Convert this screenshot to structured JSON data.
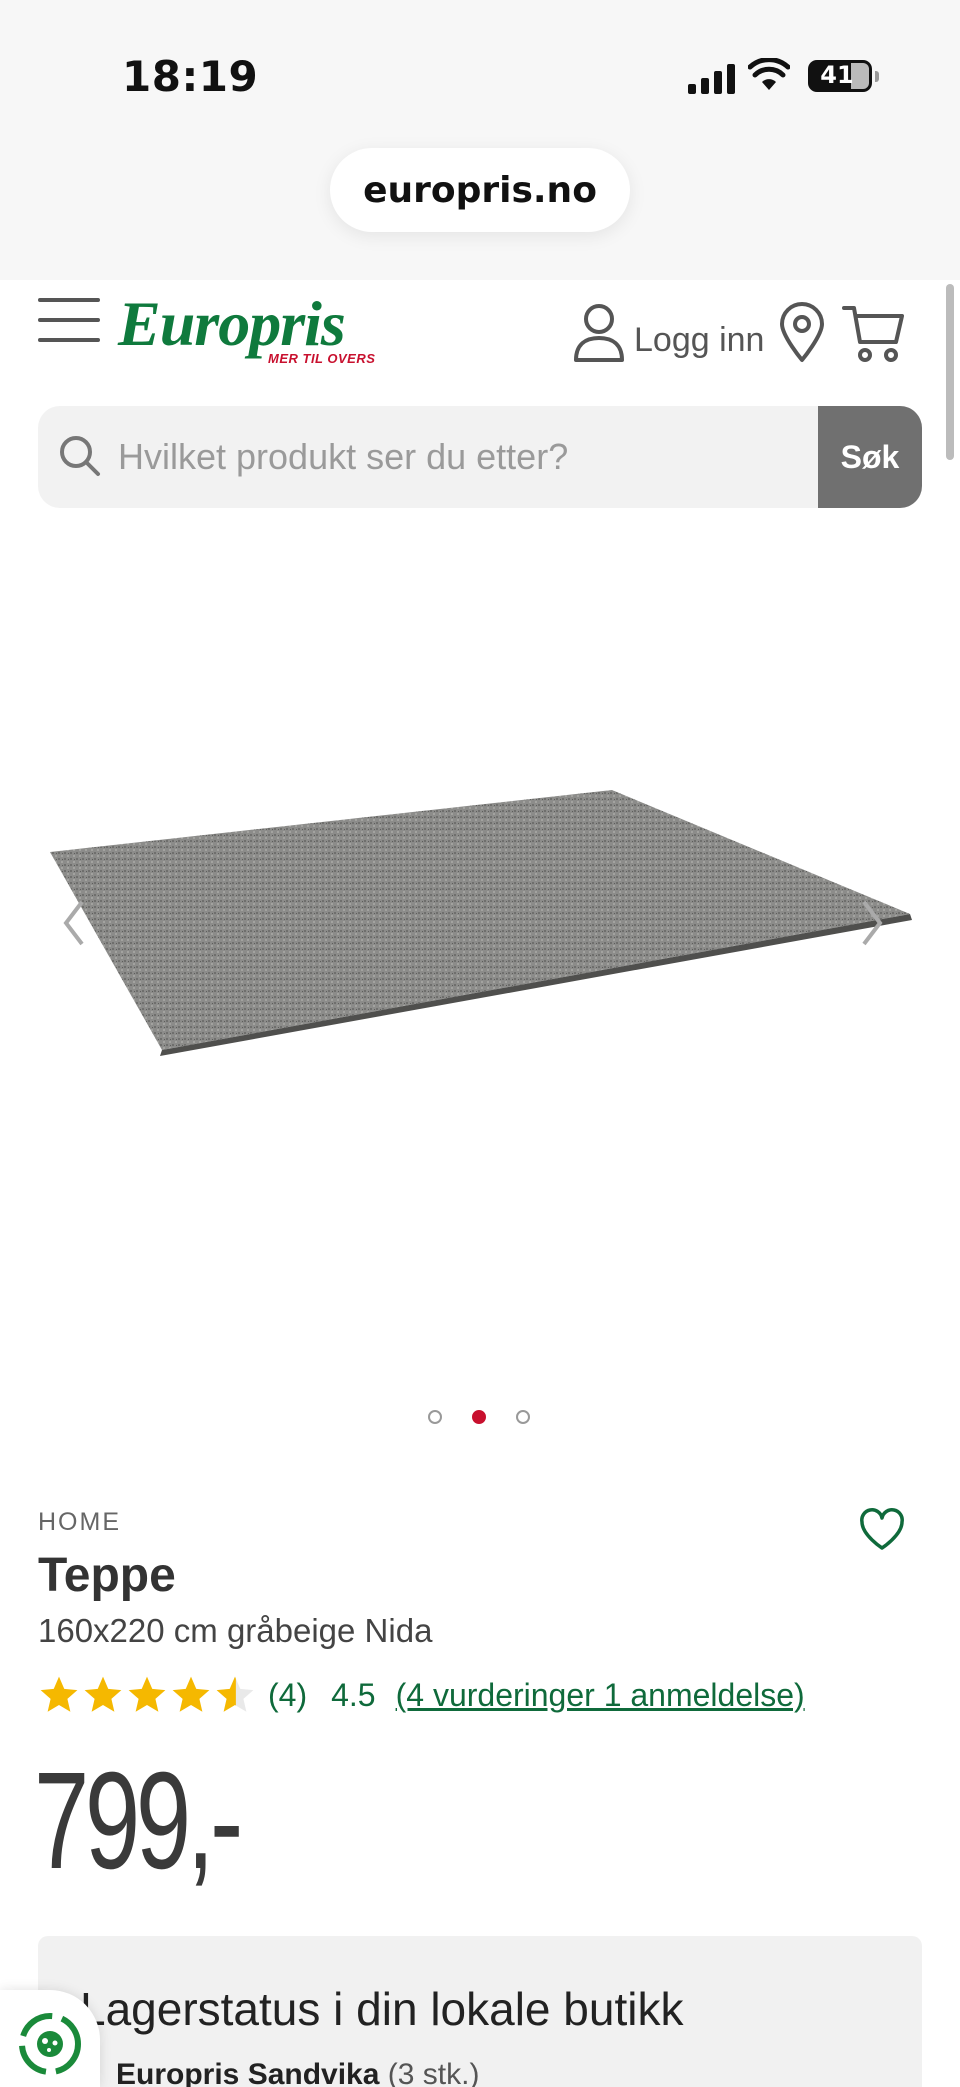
{
  "status_bar": {
    "time": "18:19",
    "battery": "41"
  },
  "browser": {
    "url": "europris.no"
  },
  "header": {
    "logo_text": "Europris",
    "logo_tagline": "MER TIL OVERS",
    "login_label": "Logg inn"
  },
  "search": {
    "placeholder": "Hvilket produkt ser du etter?",
    "button_label": "Søk"
  },
  "gallery": {
    "slide_count": 3,
    "active_slide": 2
  },
  "product": {
    "brand": "HOME",
    "title": "Teppe",
    "subtitle": "160x220 cm gråbeige Nida",
    "rating_value": 4.5,
    "rating_count": "(4)",
    "rating_score": "4.5",
    "reviews_link": "(4 vurderinger 1 anmeldelse)",
    "price": "799,-"
  },
  "stock": {
    "title": "Lagerstatus i din lokale butikk",
    "store_name": "Europris Sandvika",
    "store_qty": "(3 stk.)"
  },
  "colors": {
    "brand_green": "#0f7a3d",
    "brand_red": "#c8102e",
    "star": "#f5b800",
    "search_button": "#707070"
  }
}
